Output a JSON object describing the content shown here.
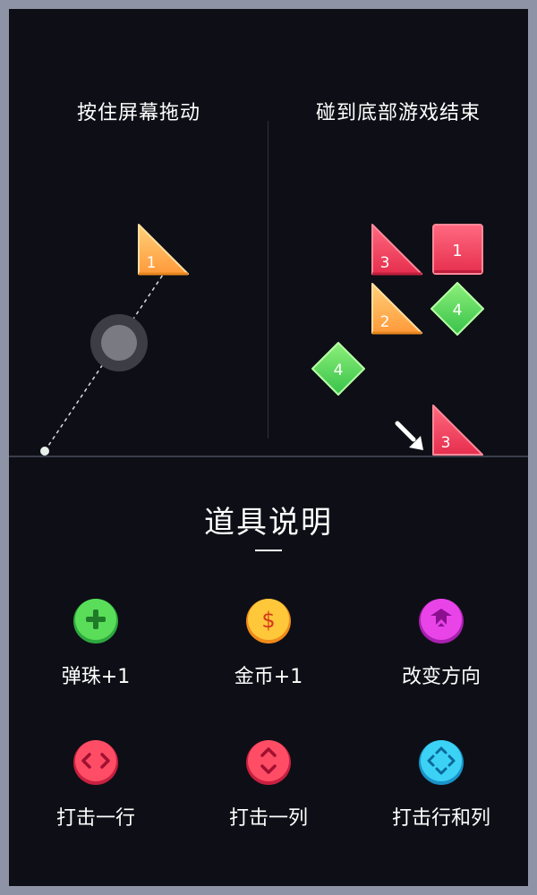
{
  "tutorial": {
    "hint_left": "按住屏幕拖动",
    "hint_right": "碰到底部游戏结束",
    "blocks": {
      "aim_triangle": "1",
      "tri_red_top": "3",
      "square_red": "1",
      "tri_orange": "2",
      "diamond_green_right": "4",
      "diamond_green_left": "4",
      "tri_red_bottom": "3"
    }
  },
  "props": {
    "title": "道具说明",
    "items": [
      {
        "label": "弹珠+1",
        "icon": "plus-ball-icon",
        "color": "#4bd65a"
      },
      {
        "label": "金币+1",
        "icon": "coin-icon",
        "color": "#ffbf2a"
      },
      {
        "label": "改变方向",
        "icon": "change-direction-icon",
        "color": "#e03be0"
      },
      {
        "label": "打击一行",
        "icon": "hit-row-icon",
        "color": "#ff4b62"
      },
      {
        "label": "打击一列",
        "icon": "hit-column-icon",
        "color": "#ff4b62"
      },
      {
        "label": "打击行和列",
        "icon": "hit-row-column-icon",
        "color": "#2cc9f2"
      }
    ]
  },
  "colors": {
    "background": "#0e0f16",
    "border": "#8e93a6",
    "triangle_orange": "#ffb04a",
    "block_red": "#f23f5c",
    "diamond_green": "#5ad64a"
  }
}
